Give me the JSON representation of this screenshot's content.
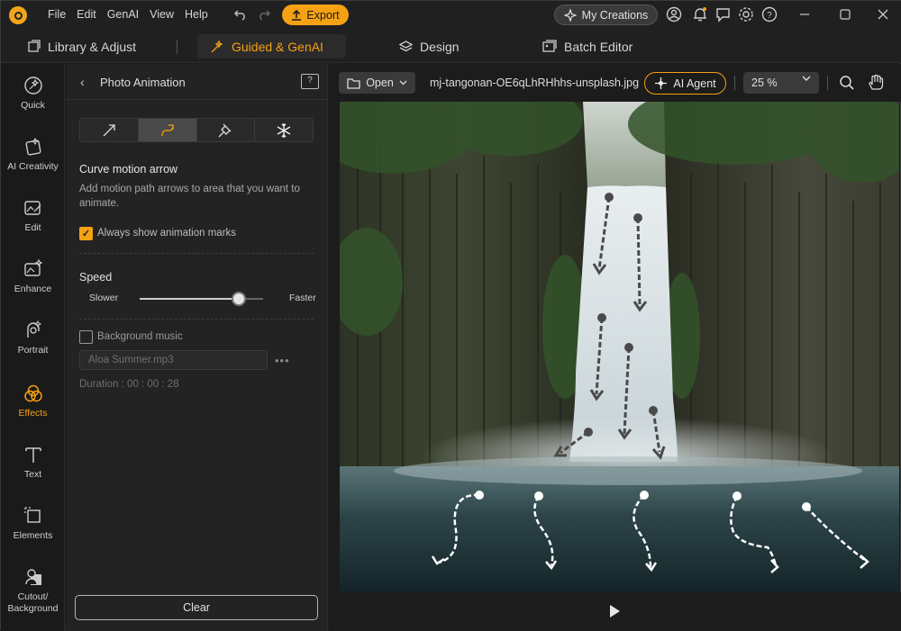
{
  "menu": {
    "file": "File",
    "edit": "Edit",
    "genai": "GenAI",
    "view": "View",
    "help": "Help"
  },
  "titlebar": {
    "export_label": "Export",
    "my_creations_label": "My Creations"
  },
  "modes": {
    "library": "Library & Adjust",
    "guided": "Guided & GenAI",
    "design": "Design",
    "batch": "Batch Editor",
    "active": "Guided & GenAI"
  },
  "rail": {
    "items": [
      {
        "label": "Quick",
        "icon": "magic-wand-icon"
      },
      {
        "label": "AI Creativity",
        "icon": "ai-creativity-icon"
      },
      {
        "label": "Edit",
        "icon": "edit-image-icon"
      },
      {
        "label": "Enhance",
        "icon": "enhance-icon"
      },
      {
        "label": "Portrait",
        "icon": "portrait-icon"
      },
      {
        "label": "Effects",
        "icon": "effects-icon"
      },
      {
        "label": "Text",
        "icon": "text-icon"
      },
      {
        "label": "Elements",
        "icon": "elements-icon"
      },
      {
        "label": "Cutout/\nBackground",
        "icon": "cutout-icon"
      }
    ],
    "active": "Effects"
  },
  "panel": {
    "title": "Photo Animation",
    "tools": [
      "straight-arrow-icon",
      "curve-arrow-icon",
      "anchor-pin-icon",
      "freeze-icon"
    ],
    "active_tool": "curve-arrow-icon",
    "section_title": "Curve motion arrow",
    "section_desc": "Add motion path arrows to area that you want to animate.",
    "always_show_label": "Always show animation marks",
    "always_show_checked": true,
    "speed_label": "Speed",
    "speed_min_label": "Slower",
    "speed_max_label": "Faster",
    "speed_value": 0.8,
    "bg_music_label": "Background music",
    "bg_music_checked": false,
    "music_placeholder": "Aloa Summer.mp3",
    "duration_text": "Duration : 00 : 00 : 28",
    "clear_label": "Clear"
  },
  "workspace": {
    "open_label": "Open",
    "filename": "mj-tangonan-OE6qLhRHhhs-unsplash.jpg",
    "ai_agent_label": "AI Agent",
    "zoom": "25 %"
  },
  "colors": {
    "accent": "#f5a114",
    "panel": "#232323",
    "bg": "#1c1c1c"
  }
}
